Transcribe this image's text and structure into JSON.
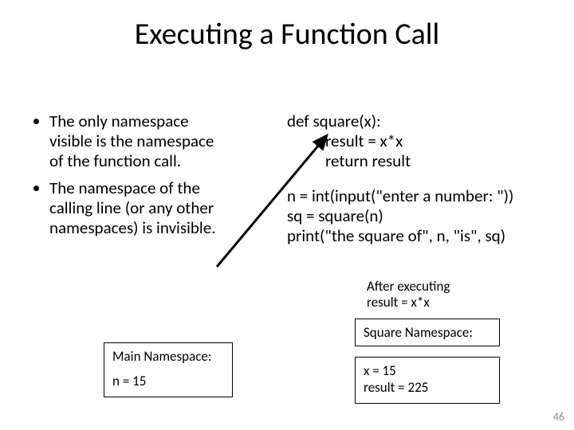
{
  "title": "Executing a Function Call",
  "bullets": [
    "The only namespace visible is the namespace of the function call.",
    "The namespace of the calling line (or any other namespaces) is invisible."
  ],
  "code": {
    "l1": "def square(x):",
    "l2": "result = x*x",
    "l3": "return result",
    "l4": "n = int(input(\"enter a number: \"))",
    "l5": "sq = square(n)",
    "l6": "print(\"the square of\", n, \"is\", sq)"
  },
  "after_exec": {
    "l1": "After executing",
    "l2": "result = x*x"
  },
  "main_ns": {
    "title": "Main Namespace:",
    "v1": "n = 15"
  },
  "square_ns": {
    "title": "Square Namespace:",
    "v1": "x = 15",
    "v2": "result = 225"
  },
  "page_number": "46"
}
